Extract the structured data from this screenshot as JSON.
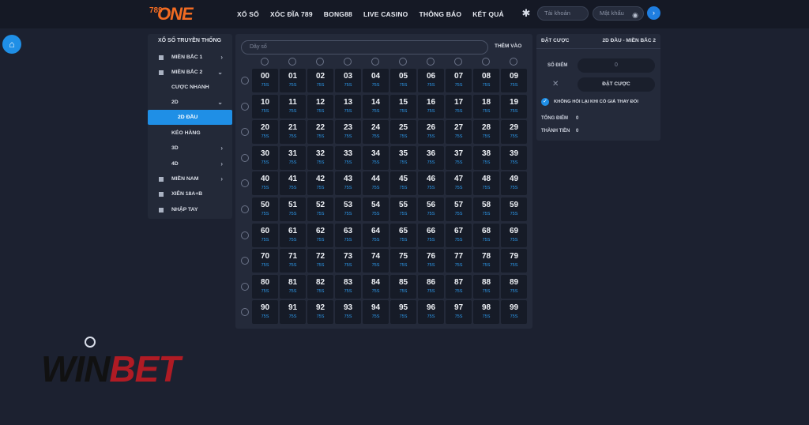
{
  "topbar": {
    "logo_num": "789",
    "logo_text": "ONE",
    "nav": [
      "XỔ SỐ",
      "XÓC ĐĨA 789",
      "BONG88",
      "LIVE CASINO",
      "THÔNG BÁO",
      "KẾT QUẢ"
    ],
    "account_placeholder": "Tài khoản",
    "password_placeholder": "Mật khẩu",
    "go_icon": "›",
    "eye_icon": "◉",
    "gear_icon": "✱"
  },
  "home_icon": "⌂",
  "sidebar": {
    "title": "XỔ SỐ TRUYỀN THỐNG",
    "items": [
      {
        "label": "MIỀN BẮC 1",
        "chev": "›",
        "square": true
      },
      {
        "label": "MIỀN BẮC 2",
        "chev": "⌄",
        "square": true
      },
      {
        "label": "CƯỢC NHANH",
        "chev": "",
        "square": false
      },
      {
        "label": "2D",
        "chev": "⌄",
        "square": false
      },
      {
        "label": "2D ĐẦU",
        "chev": "",
        "square": false,
        "active": true
      },
      {
        "label": "KÉO HÀNG",
        "chev": "",
        "square": false
      },
      {
        "label": "3D",
        "chev": "›",
        "square": false
      },
      {
        "label": "4D",
        "chev": "›",
        "square": false
      },
      {
        "label": "MIỀN NAM",
        "chev": "›",
        "square": true
      },
      {
        "label": "XIÊN 18A+B",
        "chev": "",
        "square": true
      },
      {
        "label": "NHẬP TAY",
        "chev": "",
        "square": true
      }
    ]
  },
  "board": {
    "search_placeholder": "Dãy số",
    "add_label": "THÊM VÀO",
    "rate": "75S",
    "numbers": [
      "00",
      "01",
      "02",
      "03",
      "04",
      "05",
      "06",
      "07",
      "08",
      "09",
      "10",
      "11",
      "12",
      "13",
      "14",
      "15",
      "16",
      "17",
      "18",
      "19",
      "20",
      "21",
      "22",
      "23",
      "24",
      "25",
      "26",
      "27",
      "28",
      "29",
      "30",
      "31",
      "32",
      "33",
      "34",
      "35",
      "36",
      "37",
      "38",
      "39",
      "40",
      "41",
      "42",
      "43",
      "44",
      "45",
      "46",
      "47",
      "48",
      "49",
      "50",
      "51",
      "52",
      "53",
      "54",
      "55",
      "56",
      "57",
      "58",
      "59",
      "60",
      "61",
      "62",
      "63",
      "64",
      "65",
      "66",
      "67",
      "68",
      "69",
      "70",
      "71",
      "72",
      "73",
      "74",
      "75",
      "76",
      "77",
      "78",
      "79",
      "80",
      "81",
      "82",
      "83",
      "84",
      "85",
      "86",
      "87",
      "88",
      "89",
      "90",
      "91",
      "92",
      "93",
      "94",
      "95",
      "96",
      "97",
      "98",
      "99"
    ]
  },
  "panel": {
    "title": "ĐẶT CƯỢC",
    "subtitle": "2D ĐẦU - MIỀN BẮC 2",
    "points_label": "SỐ ĐIỂM",
    "points_value": "0",
    "clear_icon": "✕",
    "bet_button": "ĐẶT CƯỢC",
    "check_icon": "✓",
    "check_label": "KHÔNG HỎI LẠI KHI CÓ GIÁ THAY ĐỔI",
    "total_points_label": "TỔNG ĐIỂM",
    "total_points_value": "0",
    "total_money_label": "THÀNH TIỀN",
    "total_money_value": "0"
  },
  "watermark": {
    "part1": "WIN",
    "part2": "BET"
  }
}
